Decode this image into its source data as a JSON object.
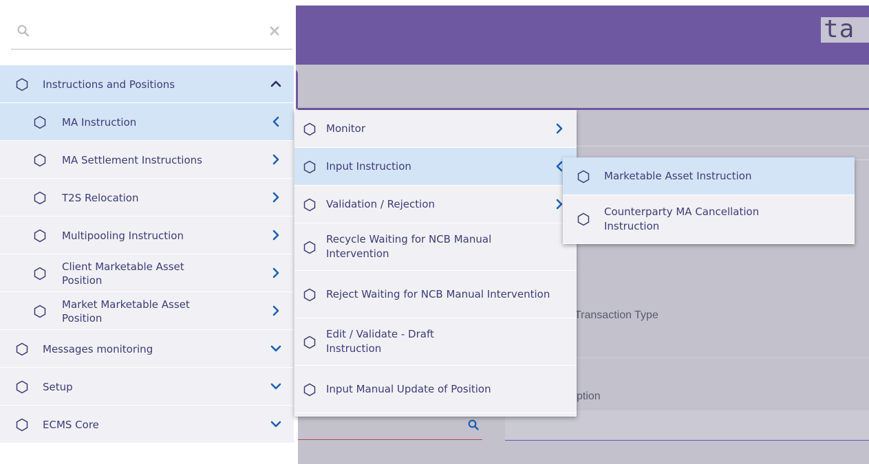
{
  "app": {
    "logo_text": "ta",
    "banner_color": "#6e58a2",
    "background_labels": {
      "transaction_type": "Transaction Type",
      "description_fragment": "ption"
    }
  },
  "search": {
    "placeholder": "",
    "value": "",
    "search_icon": "search-icon",
    "clear_icon": "close-icon"
  },
  "sidebar": {
    "items": [
      {
        "label": "Instructions and Positions",
        "icon": "hexagon-icon",
        "chevron": "chevron-up-icon",
        "state": "expanded"
      },
      {
        "label": "MA Instruction",
        "icon": "hexagon-icon",
        "chevron": "chevron-left-icon",
        "state": "open"
      },
      {
        "label": "MA Settlement Instructions",
        "icon": "hexagon-icon",
        "chevron": "chevron-right-icon"
      },
      {
        "label": "T2S Relocation",
        "icon": "hexagon-icon",
        "chevron": "chevron-right-icon"
      },
      {
        "label": "Multipooling Instruction",
        "icon": "hexagon-icon",
        "chevron": "chevron-right-icon"
      },
      {
        "label": "Client Marketable Asset Position",
        "icon": "hexagon-icon",
        "chevron": "chevron-right-icon"
      },
      {
        "label": "Market Marketable Asset Position",
        "icon": "hexagon-icon",
        "chevron": "chevron-right-icon"
      },
      {
        "label": "Messages monitoring",
        "icon": "hexagon-icon",
        "chevron": "chevron-down-icon"
      },
      {
        "label": "Setup",
        "icon": "hexagon-icon",
        "chevron": "chevron-down-icon"
      },
      {
        "label": "ECMS Core",
        "icon": "hexagon-icon",
        "chevron": "chevron-down-icon"
      }
    ]
  },
  "submenu": {
    "items": [
      {
        "label": "Monitor",
        "chevron": "chevron-right-icon"
      },
      {
        "label": "Input Instruction",
        "chevron": "chevron-left-icon",
        "state": "open"
      },
      {
        "label": "Validation / Rejection",
        "chevron": "chevron-right-icon"
      },
      {
        "label": "Recycle Waiting for NCB Manual Intervention"
      },
      {
        "label": "Reject Waiting for NCB Manual Intervention"
      },
      {
        "label": "Edit / Validate - Draft Instruction"
      },
      {
        "label": "Input Manual Update of Position"
      }
    ]
  },
  "submenu_level3": {
    "items": [
      {
        "label": "Marketable Asset Instruction",
        "state": "hover"
      },
      {
        "label": "Counterparty MA Cancellation Instruction"
      }
    ]
  },
  "colors": {
    "accent": "#6e58a2",
    "highlight": "#d4e4f7",
    "menu_bg": "#f1f0f4",
    "text": "#3c3c78",
    "chevron": "#1a5fb4"
  }
}
